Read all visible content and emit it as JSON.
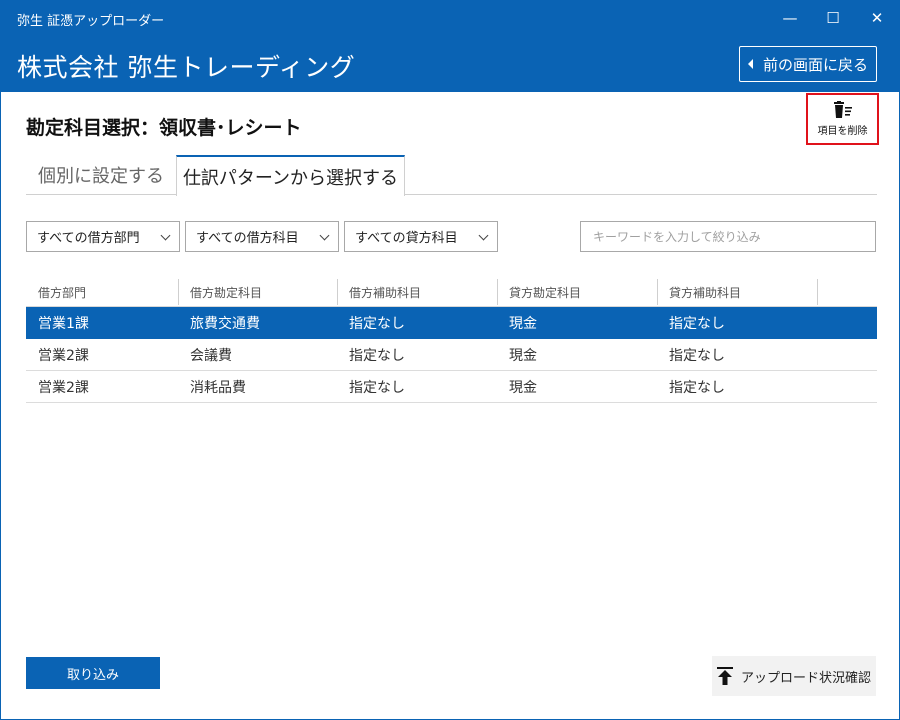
{
  "window": {
    "title": "弥生 証憑アップローダー",
    "minimize_label": "—",
    "maximize_label": "☐",
    "close_label": "✕"
  },
  "header": {
    "company_name": "株式会社 弥生トレーディング",
    "back_button_label": "前の画面に戻る"
  },
  "page": {
    "title": "勘定科目選択：領収書･レシート",
    "delete_button_label": "項目を削除"
  },
  "tabs": [
    {
      "label": "個別に設定する",
      "active": false
    },
    {
      "label": "仕訳パターンから選択する",
      "active": true
    }
  ],
  "filters": {
    "debit_department": "すべての借方部門",
    "debit_account": "すべての借方科目",
    "credit_account": "すべての貸方科目",
    "search_placeholder": "キーワードを入力して絞り込み",
    "search_value": ""
  },
  "table": {
    "columns": [
      "借方部門",
      "借方勘定科目",
      "借方補助科目",
      "貸方勘定科目",
      "貸方補助科目"
    ],
    "rows": [
      {
        "cells": [
          "営業1課",
          "旅費交通費",
          "指定なし",
          "現金",
          "指定なし"
        ],
        "selected": true
      },
      {
        "cells": [
          "営業2課",
          "会議費",
          "指定なし",
          "現金",
          "指定なし"
        ],
        "selected": false
      },
      {
        "cells": [
          "営業2課",
          "消耗品費",
          "指定なし",
          "現金",
          "指定なし"
        ],
        "selected": false
      }
    ]
  },
  "footer": {
    "import_button_label": "取り込み",
    "upload_status_label": "アップロード状況確認"
  },
  "colors": {
    "brand_blue": "#0a63b4",
    "highlight_red": "#e0121b"
  }
}
